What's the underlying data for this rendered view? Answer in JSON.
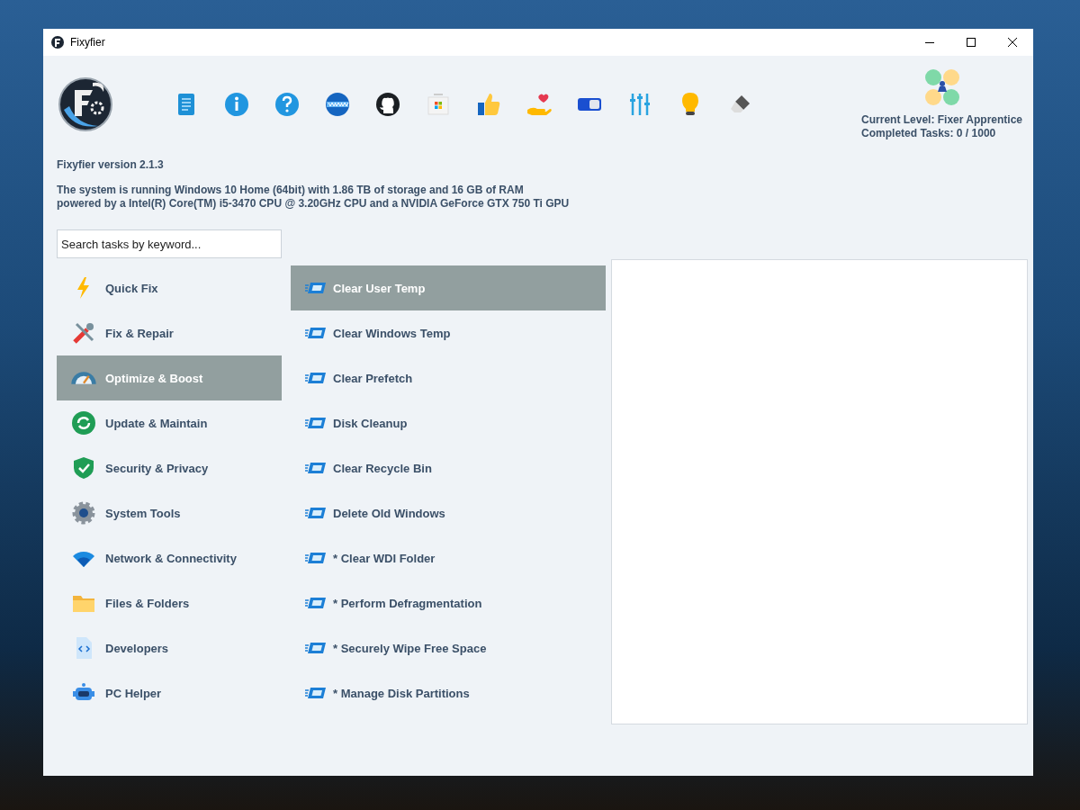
{
  "window": {
    "title": "Fixyfier"
  },
  "level": {
    "current": "Current Level: Fixer Apprentice",
    "completed": "Completed Tasks: 0 / 1000"
  },
  "version": "Fixyfier version 2.1.3",
  "system_info": [
    "The system is running Windows 10 Home (64bit) with 1.86 TB of storage and 16 GB of RAM",
    "powered by a Intel(R) Core(TM) i5-3470 CPU @ 3.20GHz CPU and a NVIDIA GeForce GTX 750 Ti GPU"
  ],
  "search": {
    "placeholder": "Search tasks by keyword..."
  },
  "categories": [
    {
      "label": "Quick Fix",
      "selected": false
    },
    {
      "label": "Fix & Repair",
      "selected": false
    },
    {
      "label": "Optimize & Boost",
      "selected": true
    },
    {
      "label": "Update & Maintain",
      "selected": false
    },
    {
      "label": "Security & Privacy",
      "selected": false
    },
    {
      "label": "System Tools",
      "selected": false
    },
    {
      "label": "Network & Connectivity",
      "selected": false
    },
    {
      "label": "Files & Folders",
      "selected": false
    },
    {
      "label": "Developers",
      "selected": false
    },
    {
      "label": "PC Helper",
      "selected": false
    }
  ],
  "tasks": [
    {
      "label": "Clear User Temp",
      "selected": true
    },
    {
      "label": "Clear Windows Temp",
      "selected": false
    },
    {
      "label": "Clear Prefetch",
      "selected": false
    },
    {
      "label": "Disk Cleanup",
      "selected": false
    },
    {
      "label": "Clear Recycle Bin",
      "selected": false
    },
    {
      "label": "Delete Old Windows",
      "selected": false
    },
    {
      "label": "* Clear WDI Folder",
      "selected": false
    },
    {
      "label": "* Perform Defragmentation",
      "selected": false
    },
    {
      "label": "* Securely Wipe Free Space",
      "selected": false
    },
    {
      "label": "* Manage Disk Partitions",
      "selected": false
    }
  ]
}
